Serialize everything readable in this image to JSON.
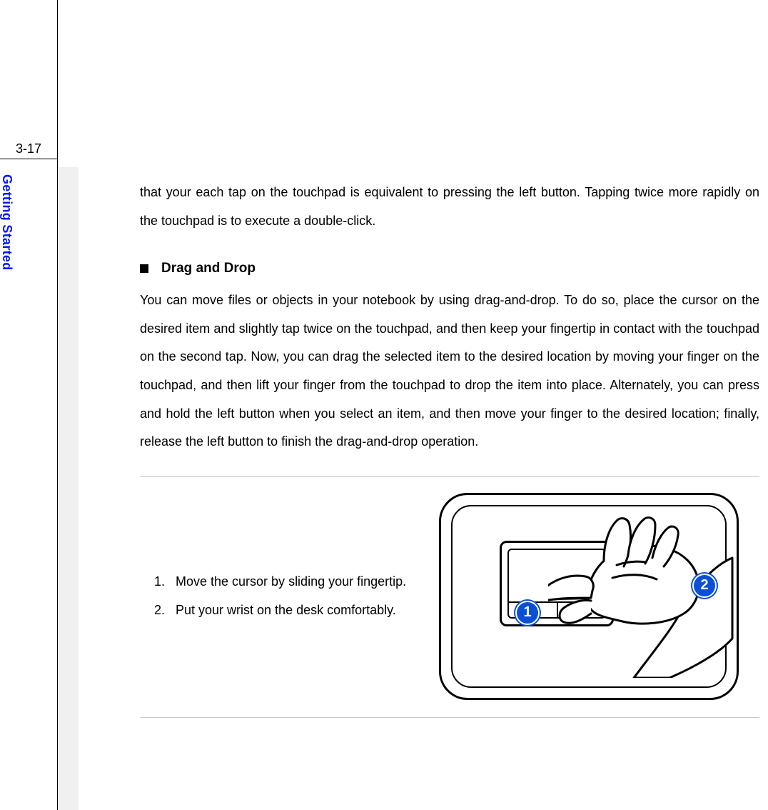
{
  "page": {
    "number": "3-17",
    "sidebar_label": "Getting Started"
  },
  "intro_text": "that your each tap on the touchpad is equivalent to pressing the left button.  Tapping twice more rapidly on the touchpad is to execute a double-click.",
  "section": {
    "title": "Drag and Drop",
    "body": "You can move files or objects in your notebook by using drag-and-drop.  To do so, place the cursor on the desired item and slightly tap twice on the touchpad, and then keep your fingertip in contact with the touchpad on the second tap.  Now, you can drag the selected item to the desired location by moving your finger on the touchpad, and then lift your finger from the touchpad to drop the item into place.   Alternately, you can press and hold the left button when you select an item, and then move your finger to the desired location; finally, release the left button to finish the drag-and-drop operation."
  },
  "steps": [
    {
      "num": "1.",
      "text": "Move the cursor by sliding your fingertip."
    },
    {
      "num": "2.",
      "text": "Put your wrist on the desk comfortably."
    }
  ],
  "figure": {
    "badge1": "1",
    "badge2": "2"
  }
}
